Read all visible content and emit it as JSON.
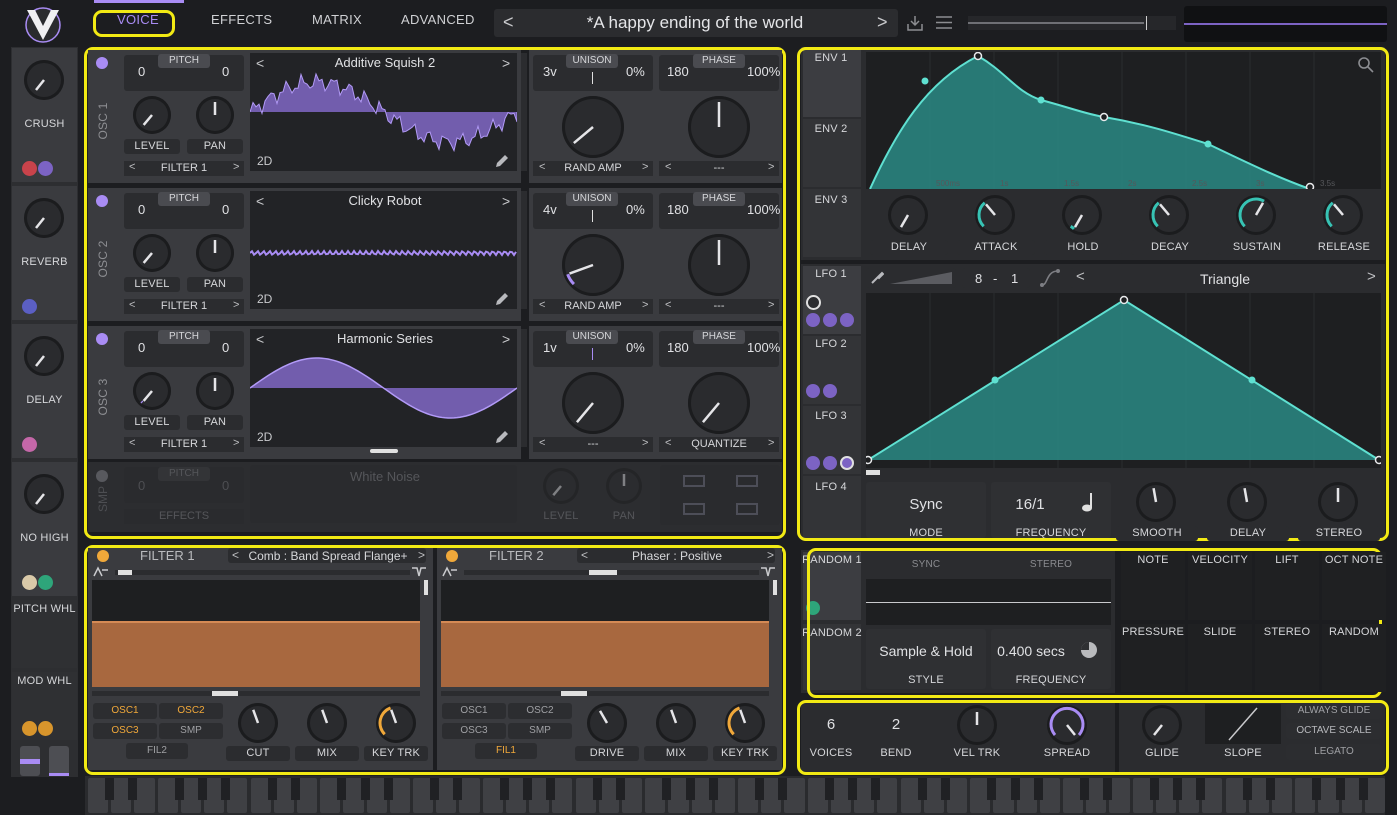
{
  "header": {
    "tabs": [
      "VOICE",
      "EFFECTS",
      "MATRIX",
      "ADVANCED"
    ],
    "preset_name": "*A happy ending of the world",
    "prev_preset": "<",
    "next_preset": ">"
  },
  "sidebar": {
    "items": [
      {
        "label": "CRUSH"
      },
      {
        "label": "REVERB"
      },
      {
        "label": "DELAY"
      },
      {
        "label": "NO HIGH"
      },
      {
        "label": "PITCH WHL"
      },
      {
        "label": "MOD WHL"
      }
    ]
  },
  "oscillators": [
    {
      "label": "OSC 1",
      "pitch_label": "PITCH",
      "pitch_left": "0",
      "pitch_right": "0",
      "wavetable": "Additive Squish 2",
      "dim": "2D",
      "level": "LEVEL",
      "pan": "PAN",
      "dest": "FILTER 1",
      "unison_label": "UNISON",
      "voices": "3v",
      "unison_pct": "0%",
      "phase_label": "PHASE",
      "phase": "180",
      "phase_pct": "100%",
      "left_sel": "RAND AMP",
      "right_sel": "---"
    },
    {
      "label": "OSC 2",
      "pitch_label": "PITCH",
      "pitch_left": "0",
      "pitch_right": "0",
      "wavetable": "Clicky Robot",
      "dim": "2D",
      "level": "LEVEL",
      "pan": "PAN",
      "dest": "FILTER 1",
      "unison_label": "UNISON",
      "voices": "4v",
      "unison_pct": "0%",
      "phase_label": "PHASE",
      "phase": "180",
      "phase_pct": "100%",
      "left_sel": "RAND AMP",
      "right_sel": "---"
    },
    {
      "label": "OSC 3",
      "pitch_label": "PITCH",
      "pitch_left": "0",
      "pitch_right": "0",
      "wavetable": "Harmonic Series",
      "dim": "2D",
      "level": "LEVEL",
      "pan": "PAN",
      "dest": "FILTER 1",
      "unison_label": "UNISON",
      "voices": "1v",
      "unison_pct": "0%",
      "phase_label": "PHASE",
      "phase": "180",
      "phase_pct": "100%",
      "left_sel": "---",
      "right_sel": "QUANTIZE"
    }
  ],
  "sampler": {
    "label": "SMP",
    "pitch_label": "PITCH",
    "pitch_left": "0",
    "pitch_right": "0",
    "sample": "White Noise",
    "dest": "EFFECTS",
    "level": "LEVEL",
    "pan": "PAN"
  },
  "filters": [
    {
      "title": "FILTER 1",
      "model": "Comb : Band Spread Flange+",
      "sources": [
        "OSC1",
        "OSC2",
        "OSC3",
        "SMP",
        "FIL2"
      ],
      "knobs": [
        "CUT",
        "MIX",
        "KEY TRK"
      ]
    },
    {
      "title": "FILTER 2",
      "model": "Phaser : Positive",
      "sources": [
        "OSC1",
        "OSC2",
        "OSC3",
        "SMP",
        "FIL1"
      ],
      "knobs": [
        "DRIVE",
        "MIX",
        "KEY TRK"
      ]
    }
  ],
  "envelopes": {
    "tabs": [
      "ENV 1",
      "ENV 2",
      "ENV 3"
    ],
    "time_marks": [
      "500ms",
      "1s",
      "1.5s",
      "2s",
      "2.5s",
      "3s",
      "3.5s"
    ],
    "knobs": [
      "DELAY",
      "ATTACK",
      "HOLD",
      "DECAY",
      "SUSTAIN",
      "RELEASE"
    ]
  },
  "lfos": {
    "tabs": [
      "LFO 1",
      "LFO 2",
      "LFO 3",
      "LFO 4"
    ],
    "rate_a": "8",
    "rate_sep": "-",
    "rate_b": "1",
    "shape": "Triangle",
    "mode_value": "Sync",
    "mode_label": "MODE",
    "freq_value": "16/1",
    "freq_label": "FREQUENCY",
    "knobs": [
      "SMOOTH",
      "DELAY",
      "STEREO"
    ]
  },
  "random": {
    "tabs": [
      "RANDOM 1",
      "RANDOM 2"
    ],
    "top_labels": [
      "SYNC",
      "STEREO"
    ],
    "style_value": "Sample & Hold",
    "style_label": "STYLE",
    "freq_value": "0.400 secs",
    "freq_label": "FREQUENCY"
  },
  "mod_sources": {
    "row1": [
      "NOTE",
      "VELOCITY",
      "LIFT",
      "OCT NOTE"
    ],
    "row2": [
      "PRESSURE",
      "SLIDE",
      "STEREO",
      "RANDOM"
    ]
  },
  "voice": {
    "voices_value": "6",
    "voices_label": "VOICES",
    "bend_value": "2",
    "bend_label": "BEND",
    "vel_trk": "VEL TRK",
    "spread": "SPREAD",
    "glide": "GLIDE",
    "slope": "SLOPE",
    "opts": [
      "ALWAYS GLIDE",
      "OCTAVE SCALE",
      "LEGATO"
    ]
  },
  "colors": {
    "accent": "#a98cf4",
    "teal": "#2ea59c",
    "filter_orange": "#b06d43",
    "highlight": "#f2ea14",
    "knob_orange": "#f0a83a"
  }
}
